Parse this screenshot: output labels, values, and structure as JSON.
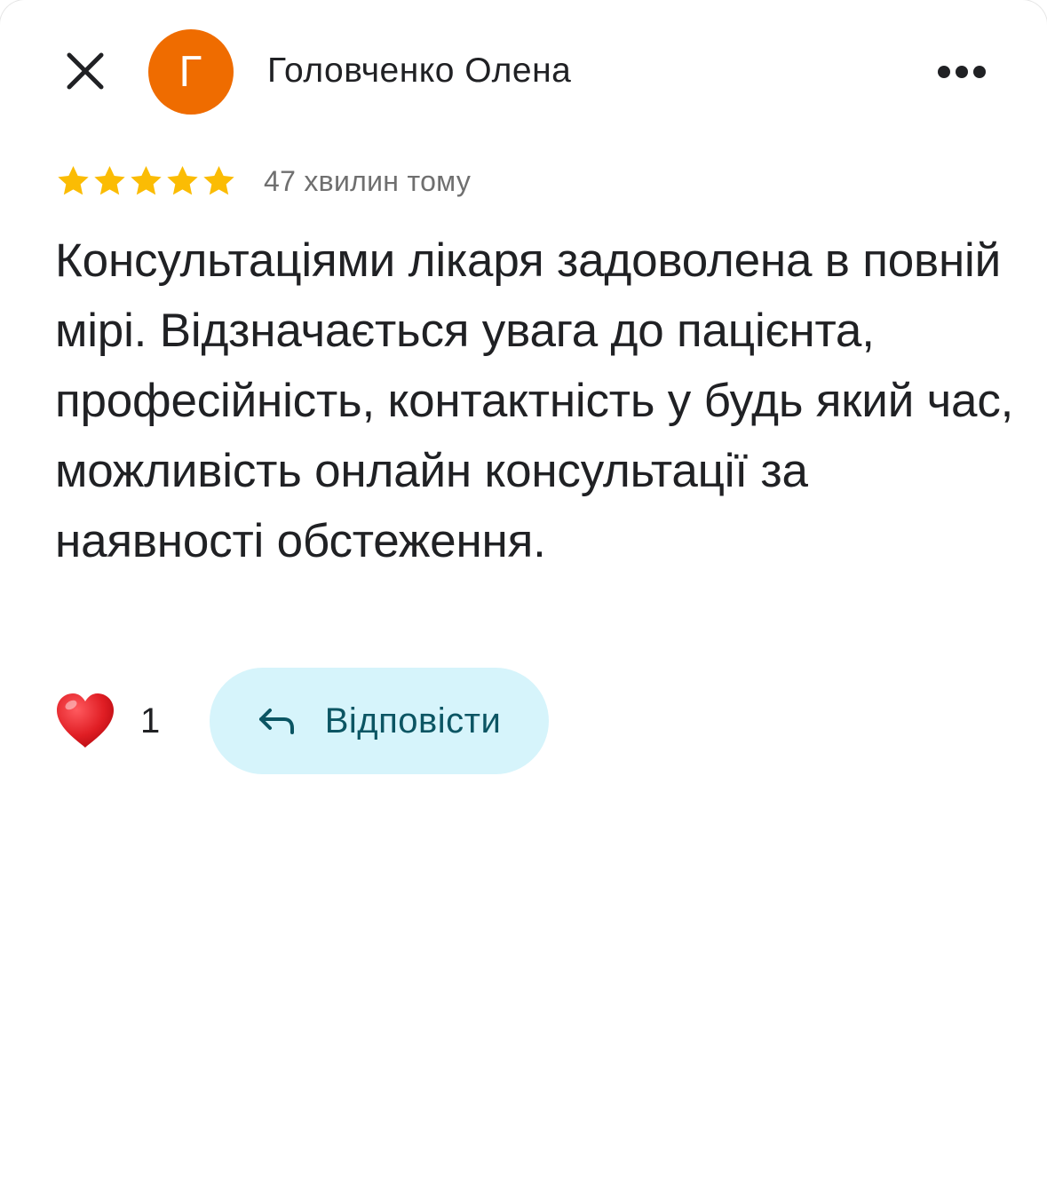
{
  "header": {
    "author_initial": "Г",
    "author_name": "Головченко Олена",
    "avatar_color": "#ef6c00"
  },
  "rating": {
    "stars": 5,
    "max_stars": 5,
    "star_color": "#fbbc04",
    "time_ago": "47 хвилин тому"
  },
  "review": {
    "text": "Консультаціями лікаря задоволена в повній мірі. Відзначається увага до пацієнта, професійність, контактність у будь який час, можливість онлайн консультації за наявності обстеження."
  },
  "actions": {
    "like_count": "1",
    "reply_label": "Відповісти",
    "reply_bg_color": "#d6f4fb"
  },
  "icons": {
    "close": "close-icon",
    "more": "more-horizontal-icon",
    "heart": "heart-icon",
    "reply": "reply-arrow-icon"
  }
}
